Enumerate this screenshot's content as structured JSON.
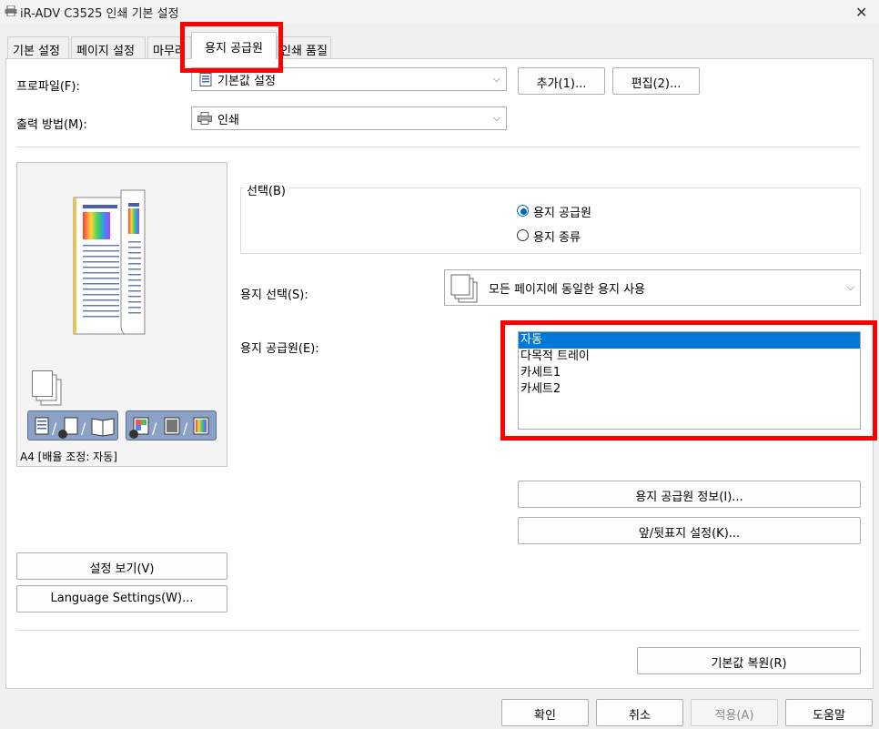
{
  "window": {
    "title": "iR-ADV C3525 인쇄 기본 설정"
  },
  "tabs": [
    {
      "label": "기본 설정"
    },
    {
      "label": "페이지 설정"
    },
    {
      "label": "마무리"
    },
    {
      "label": "용지 공급원"
    },
    {
      "label": "인쇄 품질"
    }
  ],
  "profile": {
    "label": "프로파일(F):",
    "value": "기본값 설정",
    "add_button": "추가(1)...",
    "edit_button": "편집(2)..."
  },
  "output": {
    "label": "출력 방법(M):",
    "value": "인쇄"
  },
  "preview": {
    "status": "A4 [배율 조정: 자동]"
  },
  "selection": {
    "group_label": "선택(B)",
    "options": [
      "용지 공급원",
      "용지 종류"
    ],
    "selected_index": 0
  },
  "paper_select": {
    "label": "용지 선택(S):",
    "value": "모든 페이지에 동일한 용지 사용"
  },
  "paper_source": {
    "label": "용지 공급원(E):",
    "items": [
      "자동",
      "다목적 트레이",
      "카세트1",
      "카세트2"
    ],
    "selected_index": 0
  },
  "buttons": {
    "source_info": "용지 공급원 정보(I)...",
    "cover_settings": "앞/뒷표지 설정(K)...",
    "view_settings": "설정 보기(V)",
    "language_settings": "Language Settings(W)...",
    "restore_defaults": "기본값 복원(R)",
    "ok": "확인",
    "cancel": "취소",
    "apply": "적용(A)",
    "help": "도움말"
  },
  "colors": {
    "highlight": "#ff0000",
    "selection": "#0078d7"
  }
}
